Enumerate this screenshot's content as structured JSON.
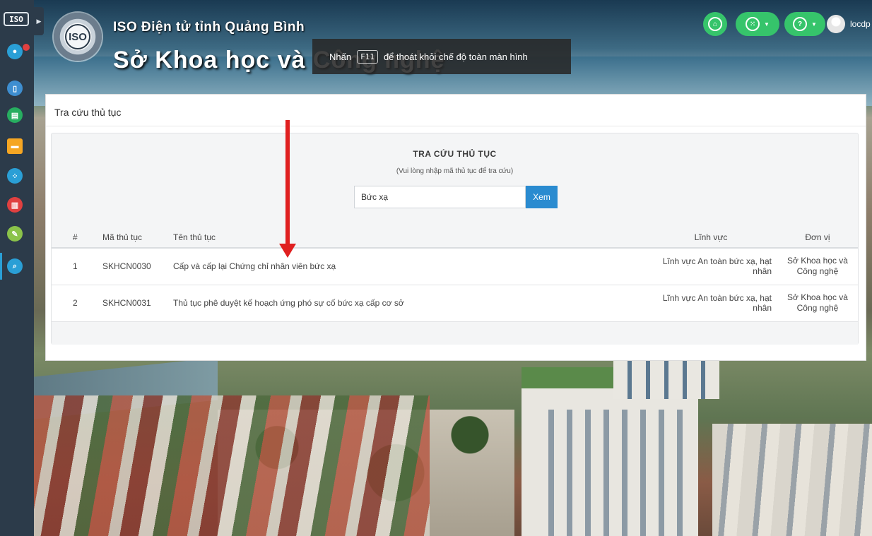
{
  "sidebar": {
    "badge": "ISO",
    "expand_icon": "triangle-right-icon",
    "items": [
      {
        "icon": "user-icon",
        "color": "#2a9fd6"
      },
      {
        "icon": "document-icon",
        "color": "#3e8ed0"
      },
      {
        "icon": "clipboard-icon",
        "color": "#27ae60"
      },
      {
        "icon": "folder-icon",
        "color": "#f5a623"
      },
      {
        "icon": "users-icon",
        "color": "#2a9fd6"
      },
      {
        "icon": "chart-icon",
        "color": "#e04040"
      },
      {
        "icon": "pen-icon",
        "color": "#8bc34a"
      },
      {
        "icon": "search-icon",
        "color": "#2a9fd6",
        "active": true
      }
    ]
  },
  "header": {
    "logo_text": "ISO",
    "subtitle": "ISO Điện tử tỉnh Quảng Bình",
    "title": "Sở Khoa học và Công nghệ",
    "fullscreen_notice": {
      "prefix": "Nhấn",
      "key": "F11",
      "suffix": "để thoát khỏi chế độ toàn màn hình"
    },
    "username": "locdp",
    "accent_color": "#36c46b"
  },
  "panel": {
    "title": "Tra cứu thủ tục",
    "search": {
      "heading": "TRA CỨU THỦ TỤC",
      "hint": "(Vui lòng nhập mã thủ tục để tra cứu)",
      "value": "Bức xạ",
      "button": "Xem"
    },
    "table": {
      "columns": {
        "index": "#",
        "code": "Mã thủ tục",
        "name": "Tên thủ tục",
        "field": "Lĩnh vực",
        "unit": "Đơn vị"
      },
      "rows": [
        {
          "index": "1",
          "code": "SKHCN0030",
          "name": "Cấp và cấp lại Chứng chỉ nhân viên bức xạ",
          "field": "Lĩnh vực An toàn bức xạ, hạt nhân",
          "unit": "Sở Khoa học và Công nghệ"
        },
        {
          "index": "2",
          "code": "SKHCN0031",
          "name": "Thủ tục phê duyệt kế hoạch ứng phó sự cố bức xạ cấp cơ sở",
          "field": "Lĩnh vực An toàn bức xạ, hạt nhân",
          "unit": "Sở Khoa học và Công nghệ"
        }
      ]
    }
  },
  "annotation_color": "#e02020"
}
